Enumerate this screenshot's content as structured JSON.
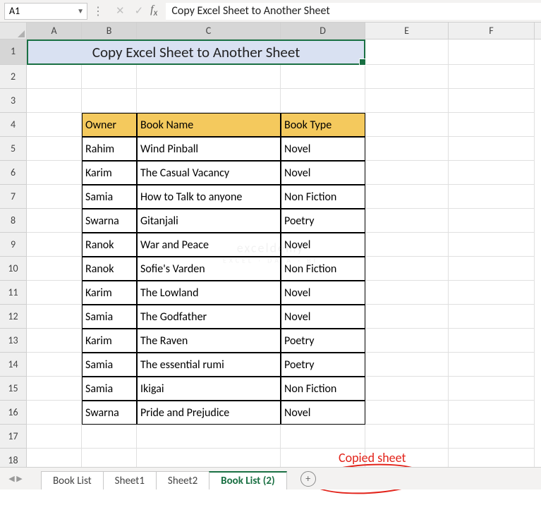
{
  "name_box": "A1",
  "formula_value": "Copy Excel Sheet to Another Sheet",
  "columns": [
    "A",
    "B",
    "C",
    "D",
    "E",
    "F"
  ],
  "row_numbers": [
    1,
    2,
    3,
    4,
    5,
    6,
    7,
    8,
    9,
    10,
    11,
    12,
    13,
    14,
    15,
    16,
    17,
    18
  ],
  "title": "Copy Excel Sheet to Another Sheet",
  "table": {
    "headers": {
      "owner": "Owner",
      "book_name": "Book Name",
      "book_type": "Book Type"
    },
    "rows": [
      {
        "owner": "Rahim",
        "book_name": "Wind Pinball",
        "book_type": "Novel"
      },
      {
        "owner": "Karim",
        "book_name": "The Casual Vacancy",
        "book_type": "Novel"
      },
      {
        "owner": "Samia",
        "book_name": "How to Talk to anyone",
        "book_type": "Non Fiction"
      },
      {
        "owner": "Swarna",
        "book_name": "Gitanjali",
        "book_type": "Poetry"
      },
      {
        "owner": "Ranok",
        "book_name": "War and Peace",
        "book_type": "Novel"
      },
      {
        "owner": "Ranok",
        "book_name": "Sofie's Varden",
        "book_type": "Non Fiction"
      },
      {
        "owner": "Karim",
        "book_name": "The Lowland",
        "book_type": "Novel"
      },
      {
        "owner": "Samia",
        "book_name": "The Godfather",
        "book_type": "Novel"
      },
      {
        "owner": "Karim",
        "book_name": "The Raven",
        "book_type": "Poetry"
      },
      {
        "owner": "Samia",
        "book_name": "The essential rumi",
        "book_type": "Poetry"
      },
      {
        "owner": "Samia",
        "book_name": "Ikigai",
        "book_type": "Non Fiction"
      },
      {
        "owner": "Swarna",
        "book_name": "Pride and Prejudice",
        "book_type": "Novel"
      }
    ]
  },
  "tabs": [
    "Book List",
    "Sheet1",
    "Sheet2",
    "Book List (2)"
  ],
  "active_tab_index": 3,
  "annotation_text": "Copied sheet",
  "watermark": {
    "main": "exceldemy",
    "sub": "EXCEL · DATA · BI"
  }
}
